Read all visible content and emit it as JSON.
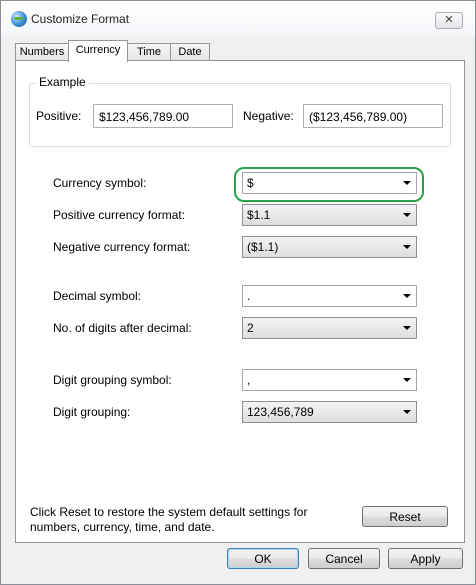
{
  "window": {
    "title": "Customize Format",
    "close_glyph": "✕"
  },
  "tabs": [
    {
      "label": "Numbers",
      "active": false
    },
    {
      "label": "Currency",
      "active": true
    },
    {
      "label": "Time",
      "active": false
    },
    {
      "label": "Date",
      "active": false
    }
  ],
  "example": {
    "group_label": "Example",
    "positive_label": "Positive:",
    "positive_value": "$123,456,789.00",
    "negative_label": "Negative:",
    "negative_value": "($123,456,789.00)"
  },
  "settings": {
    "currency_symbol": {
      "label": "Currency symbol:",
      "value": "$"
    },
    "positive_currency_format": {
      "label": "Positive currency format:",
      "value": "$1.1"
    },
    "negative_currency_format": {
      "label": "Negative currency format:",
      "value": "($1.1)"
    },
    "decimal_symbol": {
      "label": "Decimal symbol:",
      "value": "."
    },
    "digits_after_decimal": {
      "label": "No. of digits after decimal:",
      "value": "2"
    },
    "digit_grouping_symbol": {
      "label": "Digit grouping symbol:",
      "value": ","
    },
    "digit_grouping": {
      "label": "Digit grouping:",
      "value": "123,456,789"
    }
  },
  "reset_note": {
    "line1": "Click Reset to restore the system default settings for",
    "line2": "numbers, currency, time, and date."
  },
  "buttons": {
    "reset": "Reset",
    "ok": "OK",
    "cancel": "Cancel",
    "apply": "Apply"
  },
  "colors": {
    "highlight": "#2aa24a",
    "window_bg": "#f0f0f0"
  }
}
